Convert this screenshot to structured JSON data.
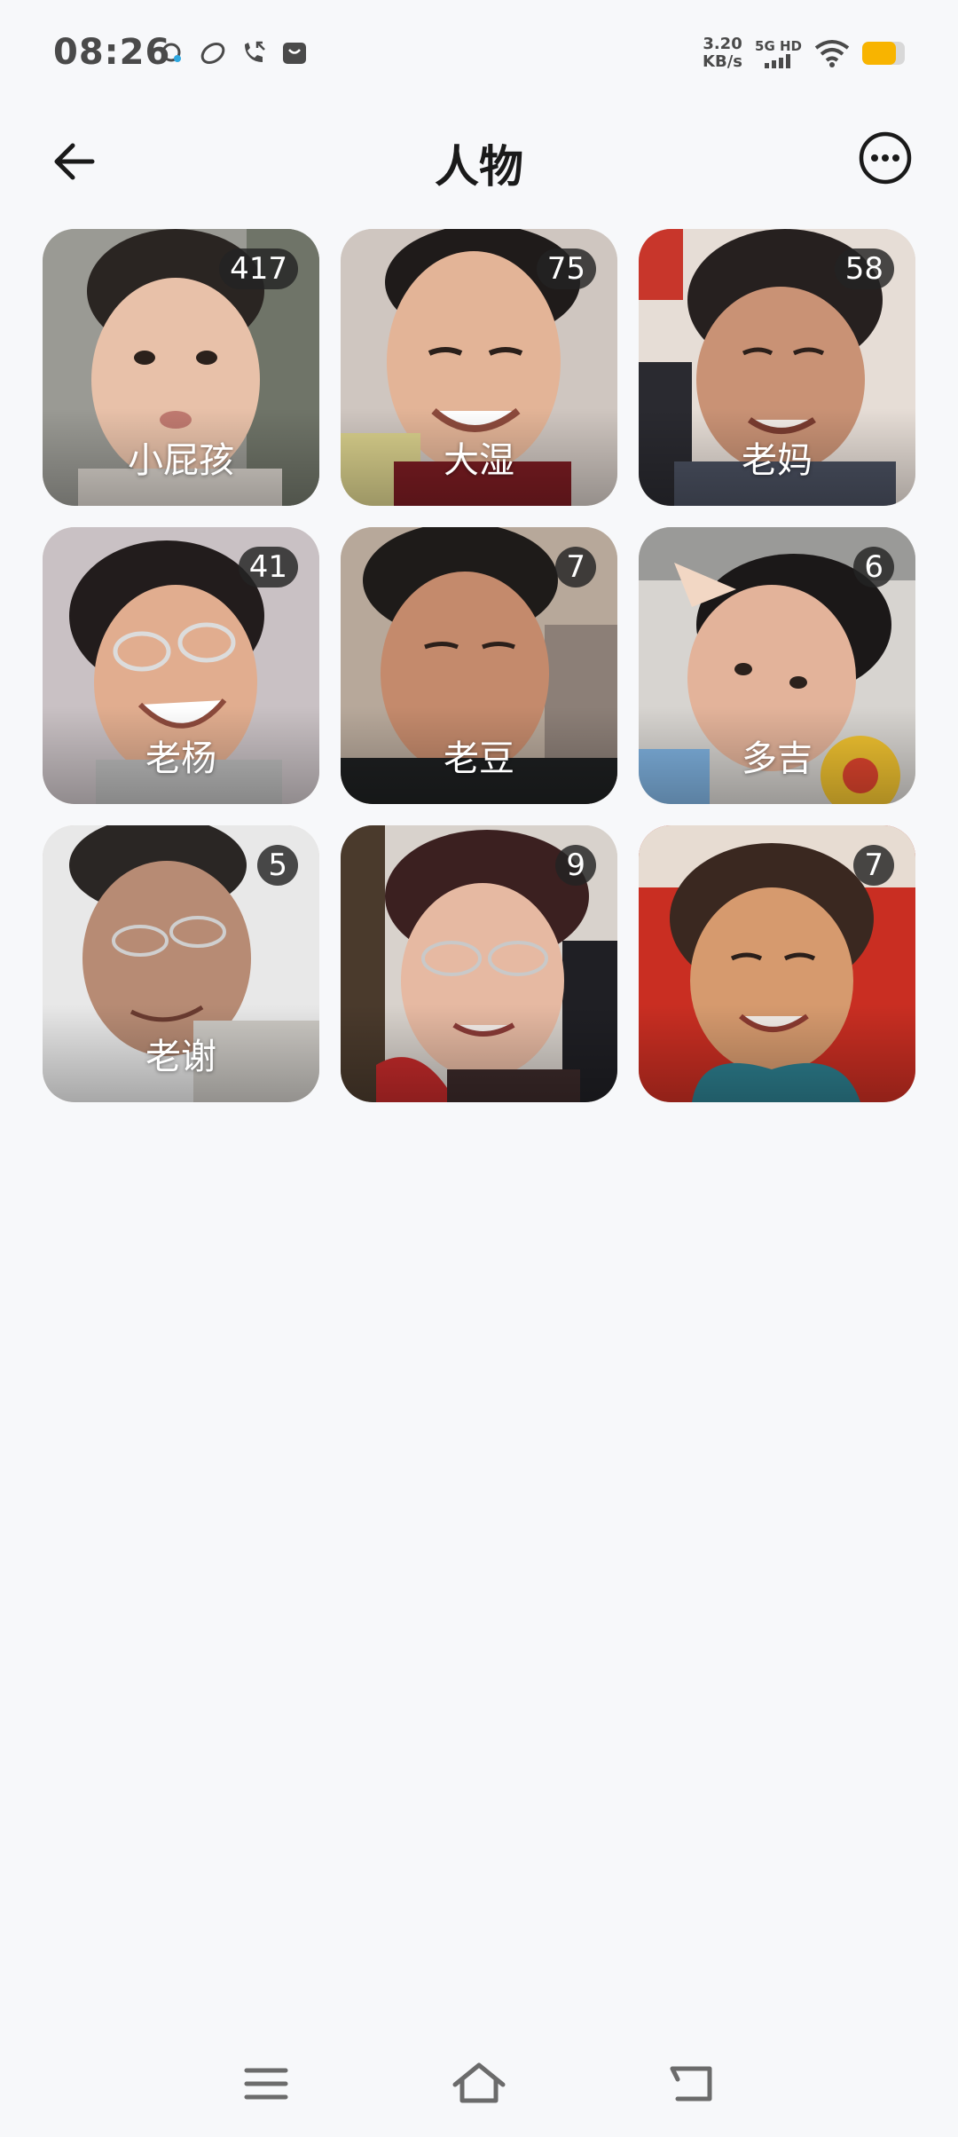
{
  "status_bar": {
    "time": "08:26",
    "net_speed_value": "3.20",
    "net_speed_unit": "KB/s",
    "network_label": "5G HD"
  },
  "header": {
    "title": "人物"
  },
  "people": [
    {
      "name": "小屁孩",
      "count": "417"
    },
    {
      "name": "大湿",
      "count": "75"
    },
    {
      "name": "老妈",
      "count": "58"
    },
    {
      "name": "老杨",
      "count": "41"
    },
    {
      "name": "老豆",
      "count": "7"
    },
    {
      "name": "多吉",
      "count": "6"
    },
    {
      "name": "老谢",
      "count": "5"
    },
    {
      "name": "",
      "count": "9"
    },
    {
      "name": "",
      "count": "7"
    }
  ],
  "colors": {
    "background": "#f7f8fa",
    "battery": "#f8b400",
    "badge": "#232323"
  },
  "battery_level": 0.8
}
